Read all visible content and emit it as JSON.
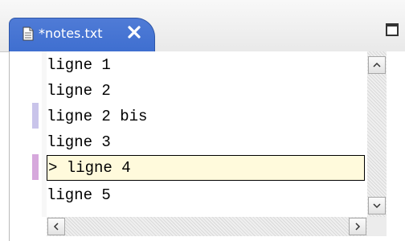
{
  "tab": {
    "title": "*notes.txt",
    "icon": "text-file-icon",
    "close_icon": "close-icon"
  },
  "toolbar": {
    "maximize_icon": "maximize-icon"
  },
  "editor": {
    "lines": [
      {
        "text": "ligne 1",
        "marker": null,
        "current": false
      },
      {
        "text": "ligne 2",
        "marker": null,
        "current": false
      },
      {
        "text": "ligne 2 bis",
        "marker": "added",
        "current": false
      },
      {
        "text": "ligne 3",
        "marker": null,
        "current": false
      },
      {
        "text": "> ligne 4",
        "marker": "changed",
        "current": true
      },
      {
        "text": "ligne 5",
        "marker": null,
        "current": false
      }
    ]
  },
  "colors": {
    "tab_active": "#4a78d4",
    "current_line_bg": "#fffadc",
    "change_added": "#c9c4ea",
    "change_changed": "#d6a8dc"
  }
}
